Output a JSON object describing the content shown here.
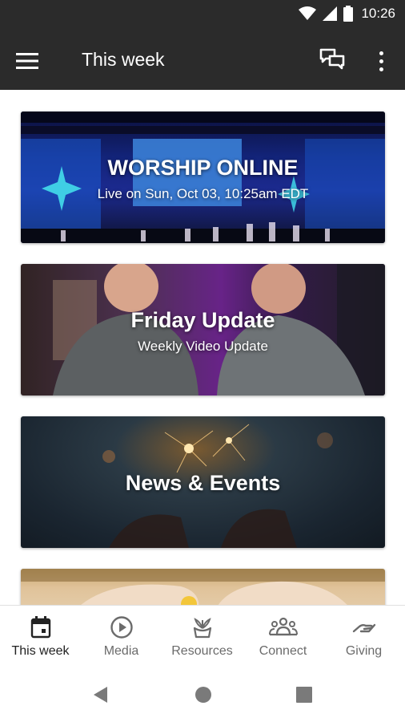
{
  "status_bar": {
    "time": "10:26"
  },
  "app_bar": {
    "title": "This week"
  },
  "cards": [
    {
      "title": "WORSHIP ONLINE",
      "subtitle": "Live on Sun, Oct 03, 10:25am EDT"
    },
    {
      "title": "Friday Update",
      "subtitle": "Weekly Video Update"
    },
    {
      "title": "News & Events",
      "subtitle": ""
    },
    {
      "title": "",
      "subtitle": ""
    }
  ],
  "bottom_nav": {
    "items": [
      {
        "label": "This week",
        "icon": "calendar-icon",
        "active": true
      },
      {
        "label": "Media",
        "icon": "play-icon",
        "active": false
      },
      {
        "label": "Resources",
        "icon": "resources-icon",
        "active": false
      },
      {
        "label": "Connect",
        "icon": "people-icon",
        "active": false
      },
      {
        "label": "Giving",
        "icon": "giving-icon",
        "active": false
      }
    ]
  },
  "colors": {
    "app_bar": "#2b2b2b",
    "active_nav": "#222222",
    "inactive_nav": "#6b6b6b"
  }
}
